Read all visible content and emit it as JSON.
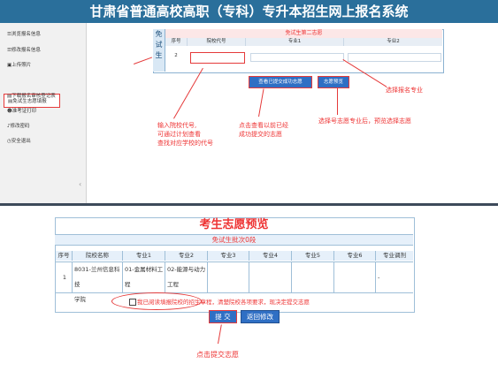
{
  "header": {
    "title": "甘肃省普通高校高职（专科）专升本招生网上报名系统"
  },
  "sidebar": {
    "items": [
      {
        "label": "☰浏览报名信息"
      },
      {
        "label": "☰修改报名信息"
      },
      {
        "label": "▣上传照片"
      },
      {
        "label": "▤免试生志愿填报"
      },
      {
        "label": "▤下载报名审核登记表"
      },
      {
        "label": "☻准考证打印"
      },
      {
        "label": "♪修改密码"
      },
      {
        "label": "◷安全退出"
      }
    ]
  },
  "form": {
    "badge_chars": [
      "免",
      "试",
      "生"
    ],
    "title": "免试生第二志愿",
    "headers": {
      "seq": "序号",
      "code": "院校代号",
      "major1": "专业1",
      "major2": "专业2"
    },
    "row": {
      "seq": "2",
      "code_value": ""
    },
    "buttons": {
      "view_submitted": "查看已提交成功志愿",
      "preview": "志愿预览"
    }
  },
  "annotations": {
    "select_major": "选择报名专业",
    "input_code": [
      "输入院校代号,",
      "可通过计划查看",
      "查找对应学校的代号"
    ],
    "view_history": [
      "点击查看以前已经",
      "成功提交的志愿"
    ],
    "after_select": "选择号志愿专业后，预览选择志愿",
    "click_submit": "点击提交志愿"
  },
  "preview": {
    "title": "考生志愿预览",
    "subtitle": "免试生批次0段",
    "headers": [
      "序号",
      "院校名称",
      "专业1",
      "专业2",
      "专业3",
      "专业4",
      "专业5",
      "专业6",
      "专业调剂"
    ],
    "row": {
      "seq": "1",
      "school": [
        "8031-兰州信息科技",
        "学院"
      ],
      "major1": [
        "01-金属材料工",
        "程"
      ],
      "major2": [
        "02-能源与动力",
        "工程"
      ],
      "adjust": "-"
    },
    "agree_text": "我已阅读填报院校的招生章程，清楚院校各项要求，现决定提交志愿",
    "submit_label": "提 交",
    "back_label": "返回修改"
  },
  "colors": {
    "header_bg": "#2a6f9b",
    "accent_red": "#e33333",
    "button_blue": "#2f6fc4"
  },
  "icons": {
    "collapse": "chevron-left-icon"
  }
}
